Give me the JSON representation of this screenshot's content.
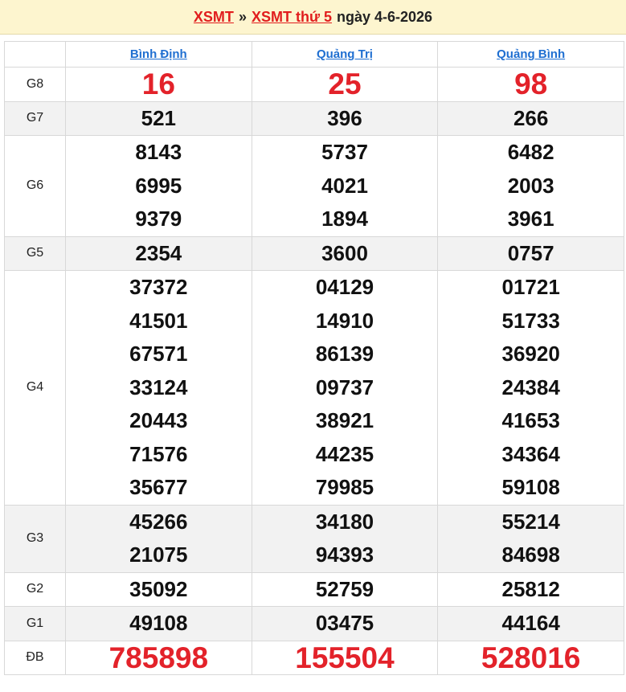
{
  "breadcrumb": {
    "link1": "XSMT",
    "separator": "»",
    "link2": "XSMT thứ 5",
    "date_text": "ngày 4-6-2026"
  },
  "provinces": [
    "Bình Định",
    "Quảng Trị",
    "Quảng Bình"
  ],
  "colors": {
    "special": "#e3222a",
    "link": "#1f6fd1",
    "header_bg": "#fdf5cf"
  },
  "prizes": [
    {
      "label": "G8",
      "shaded": false,
      "highlight": true,
      "values": [
        [
          "16"
        ],
        [
          "25"
        ],
        [
          "98"
        ]
      ]
    },
    {
      "label": "G7",
      "shaded": true,
      "highlight": false,
      "values": [
        [
          "521"
        ],
        [
          "396"
        ],
        [
          "266"
        ]
      ]
    },
    {
      "label": "G6",
      "shaded": false,
      "highlight": false,
      "values": [
        [
          "8143",
          "6995",
          "9379"
        ],
        [
          "5737",
          "4021",
          "1894"
        ],
        [
          "6482",
          "2003",
          "3961"
        ]
      ]
    },
    {
      "label": "G5",
      "shaded": true,
      "highlight": false,
      "values": [
        [
          "2354"
        ],
        [
          "3600"
        ],
        [
          "0757"
        ]
      ]
    },
    {
      "label": "G4",
      "shaded": false,
      "highlight": false,
      "values": [
        [
          "37372",
          "41501",
          "67571",
          "33124",
          "20443",
          "71576",
          "35677"
        ],
        [
          "04129",
          "14910",
          "86139",
          "09737",
          "38921",
          "44235",
          "79985"
        ],
        [
          "01721",
          "51733",
          "36920",
          "24384",
          "41653",
          "34364",
          "59108"
        ]
      ]
    },
    {
      "label": "G3",
      "shaded": true,
      "highlight": false,
      "values": [
        [
          "45266",
          "21075"
        ],
        [
          "34180",
          "94393"
        ],
        [
          "55214",
          "84698"
        ]
      ]
    },
    {
      "label": "G2",
      "shaded": false,
      "highlight": false,
      "values": [
        [
          "35092"
        ],
        [
          "52759"
        ],
        [
          "25812"
        ]
      ]
    },
    {
      "label": "G1",
      "shaded": true,
      "highlight": false,
      "values": [
        [
          "49108"
        ],
        [
          "03475"
        ],
        [
          "44164"
        ]
      ]
    },
    {
      "label": "ĐB",
      "shaded": false,
      "highlight": true,
      "values": [
        [
          "785898"
        ],
        [
          "155504"
        ],
        [
          "528016"
        ]
      ]
    }
  ]
}
